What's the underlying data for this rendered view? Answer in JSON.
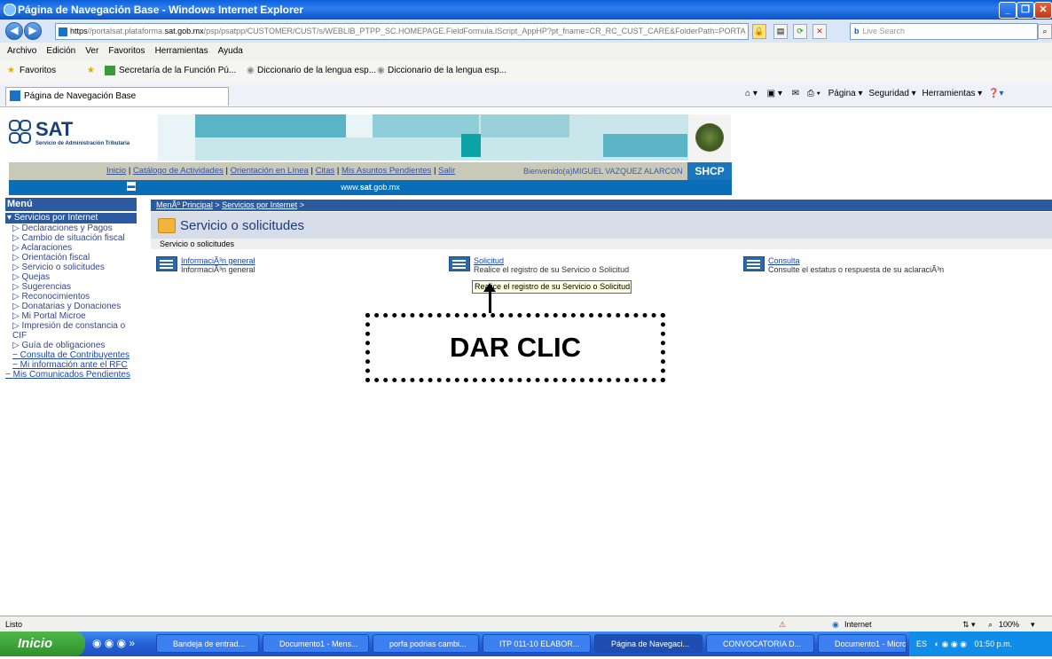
{
  "window": {
    "title": "Página de Navegación Base - Windows Internet Explorer"
  },
  "address": {
    "prefix": "https",
    "url_pre": "//portalsat.plataforma.",
    "url_domain": "sat.gob.mx",
    "url_post": "/psp/psatpp/CUSTOMER/CUST/s/WEBLIB_PTPP_SC.HOMEPAGE.FieldFormula.IScript_AppHP?pt_fname=CR_RC_CUST_CARE&FolderPath=PORTA",
    "search_placeholder": "Live Search"
  },
  "menubar": [
    "Archivo",
    "Edición",
    "Ver",
    "Favoritos",
    "Herramientas",
    "Ayuda"
  ],
  "favbar": {
    "favorites": "Favoritos",
    "items": [
      "Secretaría de la Función Pú...",
      "Diccionario de la lengua esp...",
      "Diccionario de la lengua esp..."
    ]
  },
  "tab": {
    "label": "Página de Navegación Base"
  },
  "cmdbar": {
    "page": "Página",
    "security": "Seguridad",
    "tools": "Herramientas"
  },
  "sat": {
    "logo": "SAT",
    "subtitle": "Servicio de Administración Tributaria",
    "shcp": "SHCP",
    "url_strip_pre": "www.",
    "url_strip_bold": "sat",
    "url_strip_post": ".gob.mx"
  },
  "toplinks": [
    "Inicio",
    "Catálogo de Actividades",
    "Orientación en Línea",
    "Citas",
    "Mis Asuntos Pendientes",
    "Salir"
  ],
  "welcome": "Bienvenido(a)MIGUEL VAZQUEZ ALARCON",
  "sidebar": {
    "title": "Menú",
    "selected": "Servicios por Internet",
    "items": [
      "Declaraciones y Pagos",
      "Cambio de situación fiscal",
      "Aclaraciones",
      "Orientación fiscal",
      "Servicio o solicitudes",
      "Quejas",
      "Sugerencias",
      "Reconocimientos",
      "Donatarias y Donaciones",
      "Mi Portal Microe",
      "Impresión de constancia o CIF",
      "Guía de obligaciones"
    ],
    "links": [
      "Consulta de Contribuyentes",
      "Mi información ante el RFC"
    ],
    "bottom": "Mis Comunicados Pendientes"
  },
  "breadcrumb": {
    "root": "MenÃº Principal",
    "section": "Servicios por Internet",
    "sep": ">"
  },
  "content": {
    "title": "Servicio o solicitudes",
    "subtitle": "Servicio o solicitudes",
    "options": [
      {
        "link": "InformaciÃ³n general",
        "desc": "InformaciÃ³n general"
      },
      {
        "link": "Solicitud",
        "desc": "Realice el registro de su Servicio o Solicitud"
      },
      {
        "link": "Consulta",
        "desc": "Consulte el estatus o respuesta de su aclaraciÃ³n"
      }
    ],
    "tooltip": "Realice el registro de su Servicio o Solicitud"
  },
  "callout": "DAR CLIC",
  "status": {
    "text": "Listo",
    "zone": "Internet",
    "zoom": "100%"
  },
  "taskbar": {
    "start": "Inicio",
    "tasks": [
      "Bandeja de entrad...",
      "Documento1 - Mens...",
      "porfa podrias cambi...",
      "ITP 011-10 ELABOR...",
      "Página de Navegaci...",
      "CONVOCATORIA D...",
      "Documento1 - Micro..."
    ],
    "lang": "ES",
    "clock": "01:50 p.m."
  }
}
